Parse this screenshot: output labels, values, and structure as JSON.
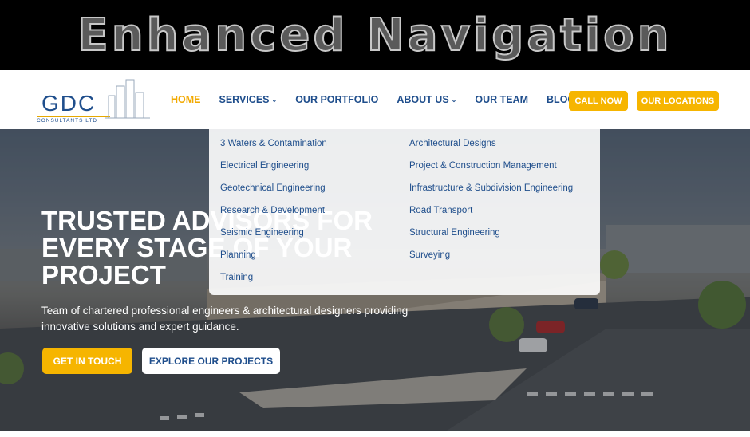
{
  "banner": {
    "title": "Enhanced Navigation"
  },
  "logo": {
    "name": "GDC",
    "sub": "CONSULTANTS LTD"
  },
  "nav": {
    "items": [
      {
        "label": "HOME",
        "active": true,
        "has_dropdown": false
      },
      {
        "label": "SERVICES",
        "active": false,
        "has_dropdown": true
      },
      {
        "label": "OUR PORTFOLIO",
        "active": false,
        "has_dropdown": false
      },
      {
        "label": "ABOUT US",
        "active": false,
        "has_dropdown": true
      },
      {
        "label": "OUR TEAM",
        "active": false,
        "has_dropdown": false
      },
      {
        "label": "BLOGS",
        "active": false,
        "has_dropdown": false
      }
    ],
    "call_label": "CALL NOW",
    "locations_label": "OUR LOCATIONS"
  },
  "services_menu": {
    "col1": [
      "3 Waters & Contamination",
      "Electrical Engineering",
      "Geotechnical Engineering",
      "Research & Development",
      "Seismic Engineering",
      "Planning",
      "Training"
    ],
    "col2": [
      "Architectural Designs",
      "Project & Construction Management",
      "Infrastructure & Subdivision Engineering",
      "Road Transport",
      "Structural Engineering",
      "Surveying"
    ]
  },
  "hero": {
    "title": "TRUSTED ADVISORS FOR EVERY STAGE OF YOUR PROJECT",
    "description": "Team of chartered professional engineers & architectural designers providing innovative solutions and expert guidance.",
    "cta_primary": "GET IN TOUCH",
    "cta_secondary": "EXPLORE OUR PROJECTS"
  },
  "colors": {
    "brand_blue": "#1f4e8c",
    "accent": "#f6b500"
  }
}
